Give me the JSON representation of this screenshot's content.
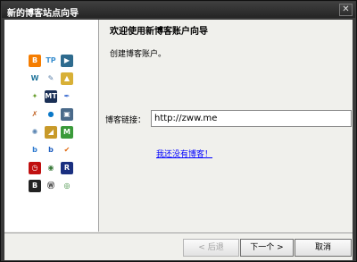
{
  "window": {
    "title": "新的博客站点向导",
    "close_glyph": "✕"
  },
  "content": {
    "heading": "欢迎使用新博客账户向导",
    "subtext": "创建博客账户。",
    "url_label": "博客链接：",
    "url_value": "http://zww.me",
    "no_blog_link": "我还没有博客！"
  },
  "buttons": {
    "back": "< 后退",
    "next": "下一个 >",
    "cancel": "取消"
  },
  "sidebar": {
    "icons": [
      {
        "name": "blogger-icon",
        "glyph": "B",
        "color": "#f57d00"
      },
      {
        "name": "typepad-icon",
        "glyph": "TP",
        "color": "#ffffff",
        "fg": "#3a8fd0"
      },
      {
        "name": "livejournal-icon",
        "glyph": "▶",
        "color": "#2e6b8e"
      },
      {
        "name": "wordpress-w-icon",
        "glyph": "W",
        "color": "#ffffff",
        "fg": "#21759b"
      },
      {
        "name": "tool-icon",
        "glyph": "✎",
        "color": "#ffffff",
        "fg": "#5a7fa8"
      },
      {
        "name": "lighthouse-icon",
        "glyph": "▲",
        "color": "#d8b036"
      },
      {
        "name": "xanga-icon",
        "glyph": "✦",
        "color": "#ffffff",
        "fg": "#6aa030"
      },
      {
        "name": "movabletype-icon",
        "glyph": "MT",
        "color": "#1a2f55"
      },
      {
        "name": "pen-icon",
        "glyph": "✒",
        "color": "#ffffff",
        "fg": "#3a6bd0"
      },
      {
        "name": "tools-icon",
        "glyph": "✗",
        "color": "#ffffff",
        "fg": "#c06020"
      },
      {
        "name": "drupal-icon",
        "glyph": "●",
        "color": "#ffffff",
        "fg": "#0a78c8"
      },
      {
        "name": "photo-icon",
        "glyph": "▣",
        "color": "#4a6a8a"
      },
      {
        "name": "settings-wheel-icon",
        "glyph": "✺",
        "color": "#ffffff",
        "fg": "#5b86b3"
      },
      {
        "name": "mountain-icon",
        "glyph": "◢",
        "color": "#c89a2a"
      },
      {
        "name": "m-blog-icon",
        "glyph": "M",
        "color": "#3a9a3a"
      },
      {
        "name": "b-blue-icon",
        "glyph": "b",
        "color": "#ffffff",
        "fg": "#2e7bd0"
      },
      {
        "name": "b-blue2-icon",
        "glyph": "b",
        "color": "#ffffff",
        "fg": "#1f5fc0"
      },
      {
        "name": "vox-icon",
        "glyph": "✔",
        "color": "#ffffff",
        "fg": "#e06a10"
      },
      {
        "name": "clock-icon",
        "glyph": "◷",
        "color": "#c01010"
      },
      {
        "name": "globe-icon",
        "glyph": "◉",
        "color": "#ffffff",
        "fg": "#3a7a3a"
      },
      {
        "name": "r-blog-icon",
        "glyph": "R",
        "color": "#1a2f80"
      },
      {
        "name": "b-black-icon",
        "glyph": "B",
        "color": "#222222"
      },
      {
        "name": "wordpress-icon",
        "glyph": "Ⓦ",
        "color": "#ffffff",
        "fg": "#333333"
      },
      {
        "name": "spiral-icon",
        "glyph": "◎",
        "color": "#ffffff",
        "fg": "#3a8a3a"
      }
    ]
  }
}
